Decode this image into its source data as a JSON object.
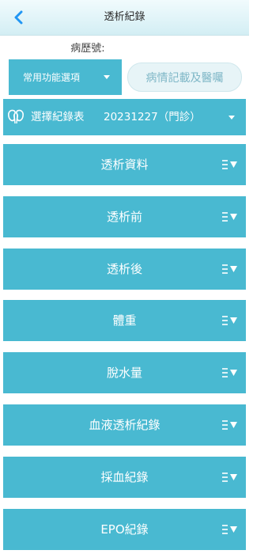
{
  "header": {
    "title": "透析紀錄"
  },
  "record_no_label": "病歷號:",
  "function_select": {
    "value": "常用功能選項"
  },
  "notes_button": {
    "label": "病情記載及醫囑"
  },
  "record_select": {
    "label": "選擇紀錄表",
    "value": "20231227（門診）"
  },
  "sections": [
    {
      "label": "透析資料"
    },
    {
      "label": "透析前"
    },
    {
      "label": "透析後"
    },
    {
      "label": "體重"
    },
    {
      "label": "脫水量"
    },
    {
      "label": "血液透析紀錄"
    },
    {
      "label": "採血紀錄"
    },
    {
      "label": "EPO紀錄"
    }
  ],
  "colors": {
    "accent": "#49b9d1",
    "header_bg": "#d3eef4",
    "back_arrow": "#2196f3"
  },
  "icons": {
    "back": "chevron-left-icon",
    "kidney": "kidney-icon",
    "section_menu": "menu-dropdown-icon"
  }
}
